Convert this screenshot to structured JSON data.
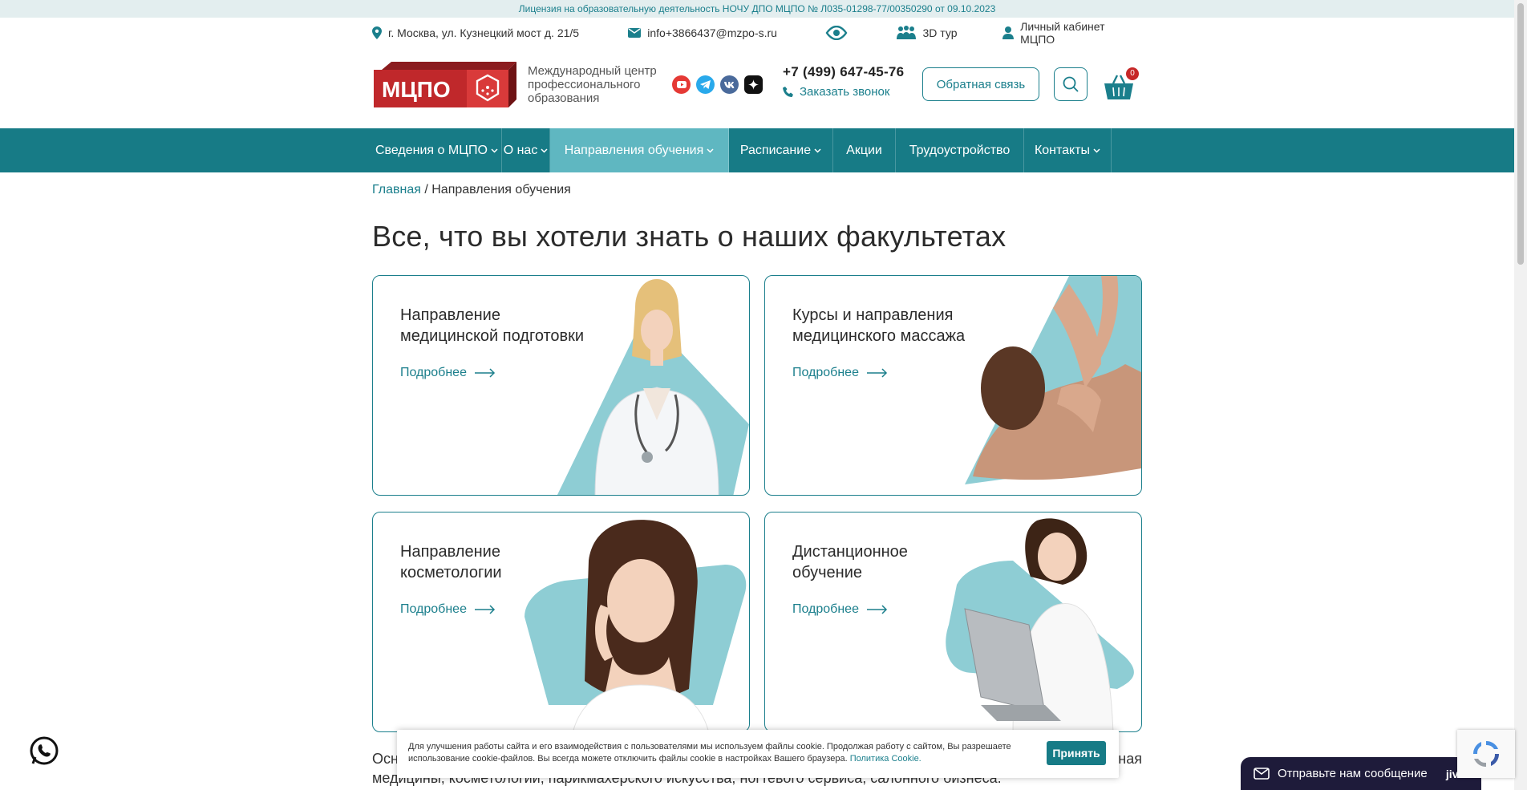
{
  "license": "Лицензия на образовательную деятельность НОЧУ ДПО МЦПО № Л035-01298-77/00350290 от 09.10.2023",
  "topbar": {
    "address": "г. Москва, ул. Кузнецкий мост д. 21/5",
    "email": "info+3866437@mzpo-s.ru",
    "tour": "3D тур",
    "cabinet": "Личный кабинет МЦПО"
  },
  "header": {
    "logo_text": "МЦПО",
    "caption": "Международный центр профессионального образования",
    "phone": "+7 (499) 647-45-76",
    "callback": "Заказать звонок",
    "feedback": "Обратная связь",
    "cart_count": "0"
  },
  "nav": {
    "items": [
      {
        "label": "Сведения о МЦПО",
        "dropdown": true
      },
      {
        "label": "О нас",
        "dropdown": true
      },
      {
        "label": "Направления обучения",
        "dropdown": true
      },
      {
        "label": "Расписание",
        "dropdown": true
      },
      {
        "label": "Акции",
        "dropdown": false
      },
      {
        "label": "Трудоустройство",
        "dropdown": false
      },
      {
        "label": "Контакты",
        "dropdown": true
      }
    ]
  },
  "breadcrumb": {
    "home": "Главная",
    "separator": " / ",
    "current": "Направления обучения"
  },
  "page": {
    "title": "Все, что вы хотели знать о наших факультетах"
  },
  "cards": [
    {
      "line1": "Направление",
      "line2": "медицинской подготовки",
      "more": "Подробнее"
    },
    {
      "line1": "Курсы и направления",
      "line2": "медицинского массажа",
      "more": "Подробнее"
    },
    {
      "line1": "Направление",
      "line2": "косметологии",
      "more": "Подробнее"
    },
    {
      "line1": "Дистанционное",
      "line2": "обучение",
      "more": "Подробнее"
    }
  ],
  "body_text": {
    "start": "Осн",
    "end": "ная",
    "line2": "медицины, косметологии, парикмахерского искусства, ногтевого сервиса, салонного бизнеса."
  },
  "cookie": {
    "text": "Для улучшения работы сайта и его взаимодействия с пользователями мы используем файлы cookie. Продолжая работу с сайтом, Вы разрешаете использование cookie-файлов. Вы всегда можете отключить файлы cookie в настройках Вашего браузера. ",
    "link": "Политика Cookie.",
    "accept": "Принять"
  },
  "jivo": {
    "label": "Отправьте нам сообщение",
    "brand": "jivo"
  },
  "colors": {
    "accent": "#177b86",
    "accent_light": "#5fb7c1",
    "shape": "#8ecdd4",
    "logo_red": "#c0282b"
  }
}
